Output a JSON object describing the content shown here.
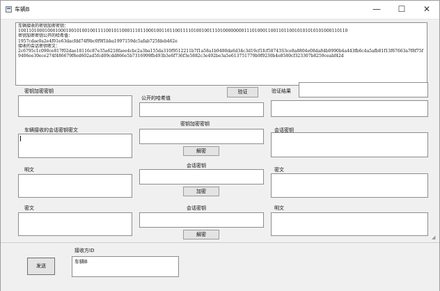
{
  "window": {
    "title": "车辆B",
    "minimize": "—",
    "maximize": "☐",
    "close": "✕"
  },
  "info_text": "车辆接收的密钥加密密钥：\n1001101000100010001001010010011110010110001110110001001101100111101001001110100000000111010001100110110010101010101000110110\n密钥加密密钥公开的哈希值：\n1957cdae0a2e4f01e63dacfdd74f9bc0f9f1bba1997159dc5afab725fdeb462e\n接收的会话密钥密文：\n2c6795c1c090ce817f02dae18116c87e35a6218faee4cbc2a3ba155da310f9512211b7f1a58a1b9480da6d34c3d19cf1fcf58743S3ce8a8804e08da84b0990b4a443fb6c4a5afb81f13f67663a7f8f75f9406ee30ece274f486679f8ed602ad5fcd09cdd866e5b7316999fb493b3e6f736f3e5882c3e492be3a5e613751779b9f9230b4e8580cf323307b8259ceabf42d",
  "labels": {
    "key_encryption_key": "密钥加密密钥",
    "public_hash": "公开的哈希值",
    "verify_button": "验证",
    "verify_result": "验证结果",
    "received_session_cipher": "车辆接收的会话密钥密文",
    "middle_key_encryption_key": "密钥加密密钥",
    "session_key_right": "会话密钥",
    "decrypt_button_1": "解密",
    "plaintext_left": "明文",
    "middle_session_key_1": "会话密钥",
    "ciphertext_right": "密文",
    "encrypt_button": "加密",
    "ciphertext_left": "密文",
    "middle_session_key_2": "会话密钥",
    "plaintext_right": "明文",
    "decrypt_button_2": "解密",
    "receiver_id": "接收方ID",
    "send_button": "发送"
  },
  "values": {
    "receiver_id": "车辆B"
  }
}
